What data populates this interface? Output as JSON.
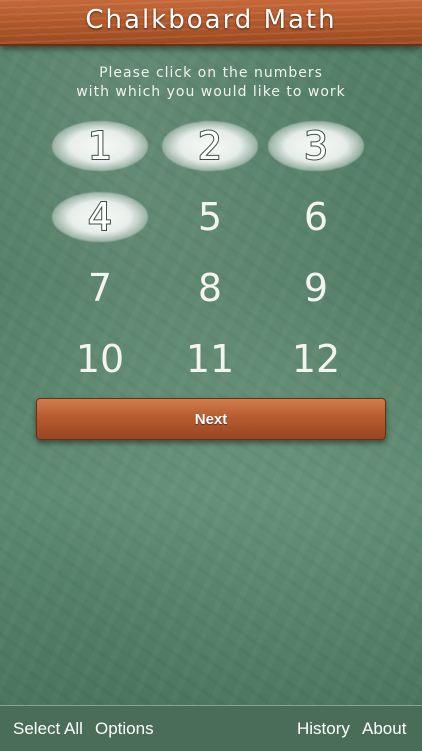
{
  "app": {
    "title": "Chalkboard Math"
  },
  "instructions": {
    "line1": "Please click on the numbers",
    "line2": "with which you would like to work"
  },
  "numbers": [
    {
      "label": "1",
      "selected": true
    },
    {
      "label": "2",
      "selected": true
    },
    {
      "label": "3",
      "selected": true
    },
    {
      "label": "4",
      "selected": true
    },
    {
      "label": "5",
      "selected": false
    },
    {
      "label": "6",
      "selected": false
    },
    {
      "label": "7",
      "selected": false
    },
    {
      "label": "8",
      "selected": false
    },
    {
      "label": "9",
      "selected": false
    },
    {
      "label": "10",
      "selected": false
    },
    {
      "label": "11",
      "selected": false
    },
    {
      "label": "12",
      "selected": false
    }
  ],
  "next_button": {
    "label": "Next"
  },
  "footer": {
    "select_all": "Select All",
    "options": "Options",
    "history": "History",
    "about": "About"
  },
  "colors": {
    "board": "#4f7b62",
    "wood": "#b35a2d",
    "chalk": "#f4f4ee"
  }
}
